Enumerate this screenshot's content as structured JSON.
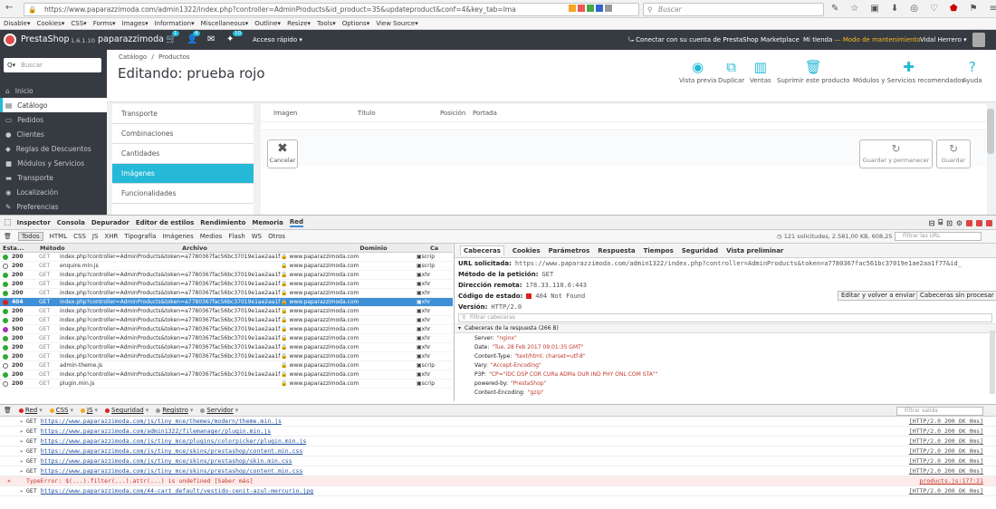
{
  "browser": {
    "url": "https://www.paparazzimoda.com/admin1322/index.php?controller=AdminProducts&id_product=35&updateproduct&conf=4&key_tab=Ima",
    "search_placeholder": "Buscar"
  },
  "webdev_toolbar": [
    "Disable▾",
    "Cookies▾",
    "CSS▾",
    "Forms▾",
    "Images▾",
    "Information▾",
    "Miscellaneous▾",
    "Outline▾",
    "Resize▾",
    "Tools▾",
    "Options▾",
    "View Source▾"
  ],
  "ps_header": {
    "logo": "PrestaShop",
    "version": "1.6.1.10",
    "shop": "paparazzimoda",
    "badge_cart": "1",
    "badge_user": "4",
    "badge_msgs": "10",
    "quick_access": "Acceso rápido ▾",
    "marketplace": "Conectar con su cuenta de PrestaShop Marketplace",
    "my_shop": "Mi tienda",
    "maintenance": "— Modo de mantenimiento",
    "user": "Vidal Herrero ▾"
  },
  "sidebar": {
    "search_placeholder": "Buscar",
    "items": [
      {
        "label": "Inicio",
        "icon": "⌂"
      },
      {
        "label": "Catálogo",
        "icon": "▤"
      },
      {
        "label": "Pedidos",
        "icon": "▭"
      },
      {
        "label": "Clientes",
        "icon": "●"
      },
      {
        "label": "Reglas de Descuentos",
        "icon": "◆"
      },
      {
        "label": "Módulos y Servicios",
        "icon": "■"
      },
      {
        "label": "Transporte",
        "icon": "▬"
      },
      {
        "label": "Localización",
        "icon": "◉"
      },
      {
        "label": "Preferencias",
        "icon": "✎"
      }
    ]
  },
  "page": {
    "breadcrumb_1": "Catálogo",
    "breadcrumb_sep": "/",
    "breadcrumb_2": "Productos",
    "title": "Editando: prueba rojo"
  },
  "toolbar_buttons": [
    {
      "label": "Vista previa",
      "icon": "◉"
    },
    {
      "label": "Duplicar",
      "icon": "⧉"
    },
    {
      "label": "Ventas",
      "icon": "▥"
    },
    {
      "label": "Suprimir este producto",
      "icon": "🗑"
    },
    {
      "label": "Módulos y Servicios recomendados",
      "icon": "✚"
    },
    {
      "label": "Ayuda",
      "icon": "?"
    }
  ],
  "product_tabs": [
    "Transporte",
    "Combinaciones",
    "Cantidades",
    "Imágenes",
    "Funcionalidades"
  ],
  "image_table_headers": [
    "Imagen",
    "Título",
    "Posición",
    "Portada"
  ],
  "panel_buttons": {
    "cancel": "Cancelar",
    "save_stay": "Guardar y permanecer",
    "save": "Guardar"
  },
  "devtools": {
    "tabs": [
      "Inspector",
      "Consola",
      "Depurador",
      "Editor de estilos",
      "Rendimiento",
      "Memoria",
      "Red"
    ],
    "filters": [
      "Todos",
      "HTML",
      "CSS",
      "JS",
      "XHR",
      "Tipografía",
      "Imágenes",
      "Medios",
      "Flash",
      "WS",
      "Otros"
    ],
    "summary": "121 solicitudes, 2.581,00 KB, 608,25 s",
    "filter_urls_placeholder": "Filtrar las URL",
    "columns": [
      "Esta...",
      "Método",
      "Archivo",
      "Dominio",
      "Ca"
    ]
  },
  "requests": [
    {
      "status": "200",
      "method": "GET",
      "file": "index.php?controller=AdminProducts&token=a7780367fac56bc37019e1ae2aa1f77...",
      "domain": "www.paparazzimoda.com",
      "cause": "script",
      "color": "#2eaa2e"
    },
    {
      "status": "200",
      "method": "GET",
      "file": "enquire.min.js",
      "domain": "www.paparazzimoda.com",
      "cause": "script",
      "color": "#ffffff"
    },
    {
      "status": "200",
      "method": "GET",
      "file": "index.php?controller=AdminProducts&token=a7780367fac56bc37019e1ae2aa1f77...",
      "domain": "www.paparazzimoda.com",
      "cause": "xhr",
      "color": "#2eaa2e"
    },
    {
      "status": "200",
      "method": "GET",
      "file": "index.php?controller=AdminProducts&token=a7780367fac56bc37019e1ae2aa1f77...",
      "domain": "www.paparazzimoda.com",
      "cause": "xhr",
      "color": "#2eaa2e"
    },
    {
      "status": "200",
      "method": "GET",
      "file": "index.php?controller=AdminProducts&token=a7780367fac56bc37019e1ae2aa1f77...",
      "domain": "www.paparazzimoda.com",
      "cause": "xhr",
      "color": "#2eaa2e"
    },
    {
      "status": "404",
      "method": "GET",
      "file": "index.php?controller=AdminProducts&token=a7780367fac56bc37019e1ae2aa1f77...",
      "domain": "www.paparazzimoda.com",
      "cause": "xhr",
      "color": "#d92121"
    },
    {
      "status": "200",
      "method": "GET",
      "file": "index.php?controller=AdminProducts&token=a7780367fac56bc37019e1ae2aa1f77...",
      "domain": "www.paparazzimoda.com",
      "cause": "xhr",
      "color": "#2eaa2e"
    },
    {
      "status": "200",
      "method": "GET",
      "file": "index.php?controller=AdminProducts&token=a7780367fac56bc37019e1ae2aa1f77...",
      "domain": "www.paparazzimoda.com",
      "cause": "xhr",
      "color": "#2eaa2e"
    },
    {
      "status": "500",
      "method": "GET",
      "file": "index.php?controller=AdminProducts&token=a7780367fac56bc37019e1ae2aa1f77...",
      "domain": "www.paparazzimoda.com",
      "cause": "xhr",
      "color": "#a532b8"
    },
    {
      "status": "200",
      "method": "GET",
      "file": "index.php?controller=AdminProducts&token=a7780367fac56bc37019e1ae2aa1f77...",
      "domain": "www.paparazzimoda.com",
      "cause": "xhr",
      "color": "#2eaa2e"
    },
    {
      "status": "200",
      "method": "GET",
      "file": "index.php?controller=AdminProducts&token=a7780367fac56bc37019e1ae2aa1f77...",
      "domain": "www.paparazzimoda.com",
      "cause": "xhr",
      "color": "#2eaa2e"
    },
    {
      "status": "200",
      "method": "GET",
      "file": "index.php?controller=AdminProducts&token=a7780367fac56bc37019e1ae2aa1f77...",
      "domain": "www.paparazzimoda.com",
      "cause": "xhr",
      "color": "#2eaa2e"
    },
    {
      "status": "200",
      "method": "GET",
      "file": "admin-theme.js",
      "domain": "www.paparazzimoda.com",
      "cause": "script",
      "color": "#ffffff"
    },
    {
      "status": "200",
      "method": "GET",
      "file": "index.php?controller=AdminProducts&token=a7780367fac56bc37019e1ae2aa1f77...",
      "domain": "www.paparazzimoda.com",
      "cause": "xhr",
      "color": "#2eaa2e"
    },
    {
      "status": "200",
      "method": "GET",
      "file": "plugin.min.js",
      "domain": "www.paparazzimoda.com",
      "cause": "script",
      "color": "#ffffff"
    }
  ],
  "details": {
    "tabs": [
      "Cabeceras",
      "Cookies",
      "Parámetros",
      "Respuesta",
      "Tiempos",
      "Seguridad",
      "Vista preliminar"
    ],
    "url_label": "URL solicitada:",
    "url_value": "https://www.paparazzimoda.com/admin1322/index.php?controller=AdminProducts&token=a7780367fac561bc37019e1ae2aa1f77&id_",
    "method_label": "Método de la petición:",
    "method_value": "GET",
    "remote_label": "Dirección remota:",
    "remote_value": "178.33.118.6:443",
    "status_label": "Código de estado:",
    "status_value": "404 Not Found",
    "version_label": "Versión:",
    "version_value": "HTTP/2.0",
    "edit_resend": "Editar y volver a enviar",
    "raw_headers": "Cabeceras sin procesar",
    "filter_headers": "Filtrar cabeceras",
    "response_headers_title": "Cabeceras de la respuesta (266 B)",
    "headers": [
      {
        "name": "Server:",
        "value": "\"nginx\""
      },
      {
        "name": "Date:",
        "value": "\"Tue, 28 Feb 2017 09:01:35 GMT\""
      },
      {
        "name": "Content-Type:",
        "value": "\"text/html; charset=utf-8\""
      },
      {
        "name": "Vary:",
        "value": "\"Accept-Encoding\""
      },
      {
        "name": "P3P:",
        "value": "\"CP=\"IDC DSP COR CURa ADMa OUR IND PHY ONL COM STA\"\""
      },
      {
        "name": "powered-by:",
        "value": "\"PrestaShop\""
      },
      {
        "name": "Content-Encoding:",
        "value": "\"gzip\""
      }
    ]
  },
  "console_filters": [
    "Red",
    "CSS",
    "JS",
    "Seguridad",
    "Registro",
    "Servidor"
  ],
  "console_filter_placeholder": "Filtrar salida",
  "console_rows": [
    {
      "method": "GET",
      "url": "https://www.paparazzimoda.com/js/tiny_mce/themes/modern/theme.min.js",
      "status": "[HTTP/2.0 200 OK 0ms]",
      "error": false
    },
    {
      "method": "GET",
      "url": "https://www.paparazzimoda.com/admin1322/filemanager/plugin.min.js",
      "status": "[HTTP/2.0 200 OK 0ms]",
      "error": false
    },
    {
      "method": "GET",
      "url": "https://www.paparazzimoda.com/js/tiny_mce/plugins/colorpicker/plugin.min.js",
      "status": "[HTTP/2.0 200 OK 0ms]",
      "error": false
    },
    {
      "method": "GET",
      "url": "https://www.paparazzimoda.com/js/tiny_mce/skins/prestashop/content.min.css",
      "status": "[HTTP/2.0 200 OK 0ms]",
      "error": false
    },
    {
      "method": "GET",
      "url": "https://www.paparazzimoda.com/js/tiny_mce/skins/prestashop/skin.min.css",
      "status": "[HTTP/2.0 200 OK 0ms]",
      "error": false
    },
    {
      "method": "GET",
      "url": "https://www.paparazzimoda.com/js/tiny_mce/skins/prestashop/content.min.css",
      "status": "[HTTP/2.0 200 OK 0ms]",
      "error": false
    },
    {
      "method": "TypeError:",
      "url": "$(...).filter(...).attr(...) is undefined [Saber más]",
      "status": "products.js:177:21",
      "error": true
    },
    {
      "method": "GET",
      "url": "https://www.paparazzimoda.com/44-cart_default/vestido-cenit-azul-mercurio.jpg",
      "status": "[HTTP/2.0 200 OK 0ms]",
      "error": false
    }
  ],
  "colors": {
    "accent": "#25b9d7",
    "dark": "#363a41",
    "selected_row": "#3d8fd6"
  }
}
